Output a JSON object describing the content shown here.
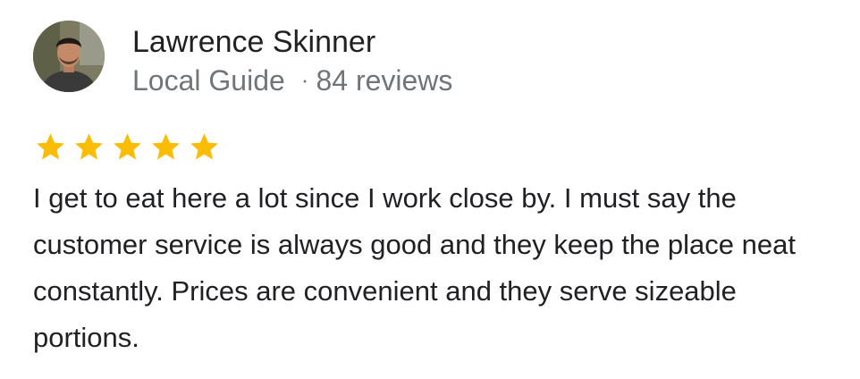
{
  "reviewer": {
    "name": "Lawrence Skinner",
    "badge": "Local Guide",
    "separator": "·",
    "review_count": "84 reviews",
    "avatar_icon": "user-avatar-photo"
  },
  "rating": {
    "value": 5,
    "max": 5,
    "star_color": "#fbbc04"
  },
  "review": {
    "text": "I get to eat here a lot since I work close by. I must say the customer service is always good and they keep the place neat constantly. Prices are convenient and they serve sizeable portions."
  }
}
